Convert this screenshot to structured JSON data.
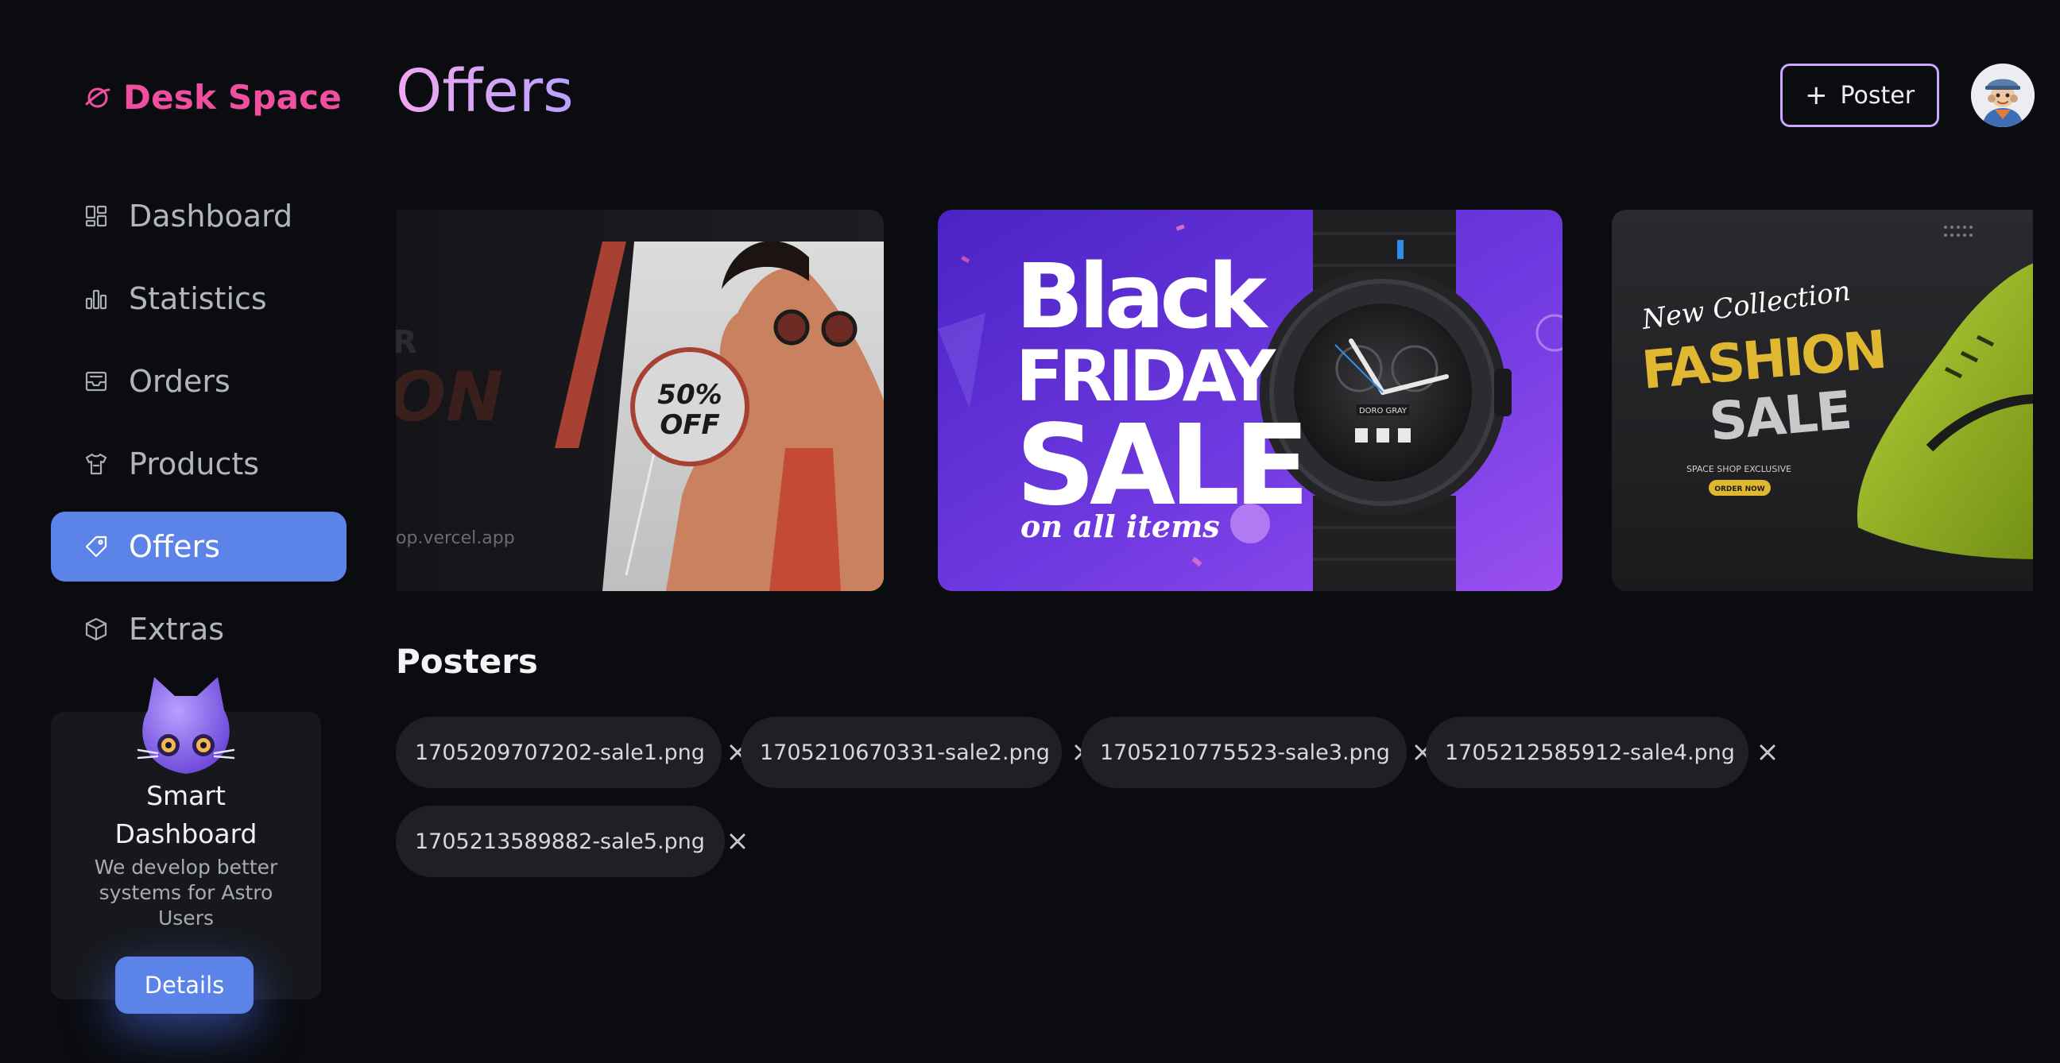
{
  "app": {
    "brand": "Desk Space"
  },
  "sidebar": {
    "items": [
      {
        "label": "Dashboard",
        "icon": "dashboard-icon",
        "active": false
      },
      {
        "label": "Statistics",
        "icon": "bar-chart-icon",
        "active": false
      },
      {
        "label": "Orders",
        "icon": "inbox-icon",
        "active": false
      },
      {
        "label": "Products",
        "icon": "shirt-icon",
        "active": false
      },
      {
        "label": "Offers",
        "icon": "tag-icon",
        "active": true
      },
      {
        "label": "Extras",
        "icon": "cube-icon",
        "active": false
      }
    ],
    "promo": {
      "title": "Smart Dashboard",
      "description": "We develop better systems for Astro Users",
      "button": "Details"
    }
  },
  "header": {
    "title": "Offers",
    "add_button": "Poster"
  },
  "banners": [
    {
      "kind": "summer-sale",
      "fragment_top": "R",
      "fragment_mid": "ON",
      "discount_line1": "50%",
      "discount_line2": "OFF",
      "url_fragment": "op.vercel.app"
    },
    {
      "kind": "black-friday",
      "line1": "Black",
      "line2": "FRIDAY",
      "line3": "SALE",
      "tagline": "on all items",
      "watch_brand": "DORO GRAY"
    },
    {
      "kind": "fashion-sale",
      "line1": "New Collection",
      "line2": "FASHION",
      "line3": "SALE",
      "small_text": "SPACE SHOP EXCLUSIVE",
      "cta": "ORDER NOW"
    }
  ],
  "posters": {
    "title": "Posters",
    "files": [
      "1705209707202-sale1.png",
      "1705210670331-sale2.png",
      "1705210775523-sale3.png",
      "1705212585912-sale4.png",
      "1705213589882-sale5.png"
    ]
  },
  "colors": {
    "background": "#0b0c10",
    "accent": "#5b83e8",
    "brand": "#f04fa0",
    "chip": "#1f2024"
  }
}
